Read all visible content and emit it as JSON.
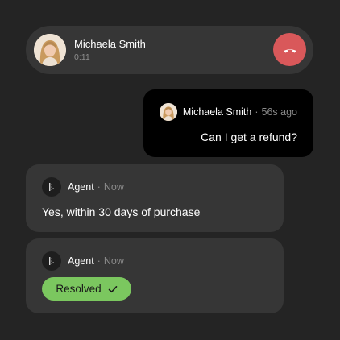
{
  "call": {
    "name": "Michaela Smith",
    "timer": "0:11",
    "hangup_color": "#d9585a"
  },
  "messages": {
    "user": {
      "name": "Michaela Smith",
      "separator": "·",
      "time": "56s ago",
      "text": "Can I get a refund?"
    },
    "agent_reply": {
      "name": "Agent",
      "separator": "·",
      "time": "Now",
      "text": "Yes, within 30 days of purchase"
    },
    "agent_status": {
      "name": "Agent",
      "separator": "·",
      "time": "Now",
      "badge": "Resolved",
      "badge_color": "#7bc75f"
    }
  },
  "icons": {
    "hangup": "phone-hangup-icon",
    "agent": "agent-logo-icon",
    "check": "check-icon"
  }
}
